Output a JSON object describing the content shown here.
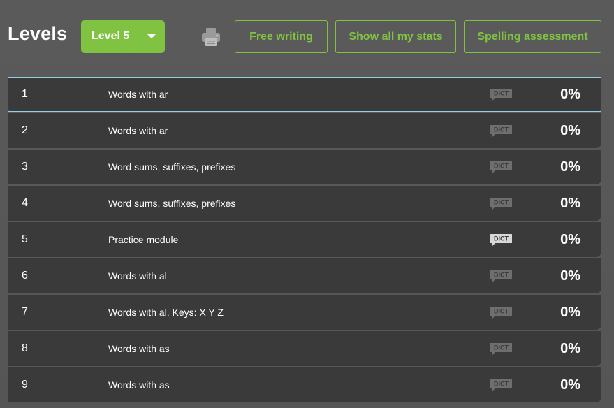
{
  "header": {
    "title": "Levels",
    "level_select": {
      "selected": "Level 5"
    },
    "print_icon": "printer-icon",
    "buttons": {
      "free_writing": "Free writing",
      "show_stats": "Show all my stats",
      "spelling_assessment": "Spelling assessment"
    }
  },
  "colors": {
    "accent": "#80c342",
    "background": "#5a5a5a",
    "row_background": "#3a3a3a",
    "selected_border": "#8fd3e3",
    "dict_inactive": "#6e6e6e",
    "dict_active": "#d8d8d8"
  },
  "modules": [
    {
      "number": "1",
      "name": "Words with ar",
      "dict_label": "DICT",
      "progress": "0%",
      "dict_active": false,
      "selected": true
    },
    {
      "number": "2",
      "name": "Words with ar",
      "dict_label": "DICT",
      "progress": "0%",
      "dict_active": false,
      "selected": false
    },
    {
      "number": "3",
      "name": "Word sums, suffixes, prefixes",
      "dict_label": "DICT",
      "progress": "0%",
      "dict_active": false,
      "selected": false
    },
    {
      "number": "4",
      "name": "Word sums, suffixes, prefixes",
      "dict_label": "DICT",
      "progress": "0%",
      "dict_active": false,
      "selected": false
    },
    {
      "number": "5",
      "name": "Practice module",
      "dict_label": "DICT",
      "progress": "0%",
      "dict_active": true,
      "selected": false
    },
    {
      "number": "6",
      "name": "Words with al",
      "dict_label": "DICT",
      "progress": "0%",
      "dict_active": false,
      "selected": false
    },
    {
      "number": "7",
      "name": "Words with al, Keys: X Y Z",
      "dict_label": "DICT",
      "progress": "0%",
      "dict_active": false,
      "selected": false
    },
    {
      "number": "8",
      "name": "Words with as",
      "dict_label": "DICT",
      "progress": "0%",
      "dict_active": false,
      "selected": false
    },
    {
      "number": "9",
      "name": "Words with as",
      "dict_label": "DICT",
      "progress": "0%",
      "dict_active": false,
      "selected": false
    }
  ]
}
